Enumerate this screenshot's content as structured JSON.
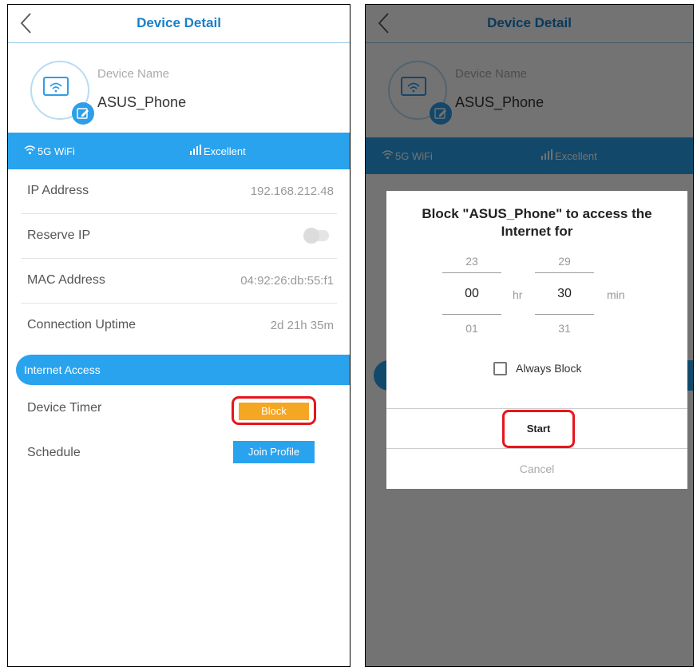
{
  "header": {
    "title": "Device Detail"
  },
  "device": {
    "name_label": "Device Name",
    "name": "ASUS_Phone"
  },
  "wifi_bar": {
    "band": "5G WiFi",
    "signal": "Excellent"
  },
  "rows": [
    {
      "label": "IP Address",
      "value": "192.168.212.48"
    },
    {
      "label": "Reserve IP",
      "value": ""
    },
    {
      "label": "MAC Address",
      "value": "04:92:26:db:55:f1"
    },
    {
      "label": "Connection Uptime",
      "value": "2d 21h 35m"
    }
  ],
  "internet_access": {
    "title": "Internet Access",
    "device_timer_label": "Device Timer",
    "block_label": "Block",
    "schedule_label": "Schedule",
    "join_label": "Join Profile"
  },
  "dialog": {
    "title": "Block \"ASUS_Phone\" to access the Internet for",
    "hours": {
      "prev": "23",
      "current": "00",
      "next": "01",
      "unit": "hr"
    },
    "minutes": {
      "prev": "29",
      "current": "30",
      "next": "31",
      "unit": "min"
    },
    "always_block_label": "Always Block",
    "always_block_checked": false,
    "start_label": "Start",
    "cancel_label": "Cancel"
  },
  "colors": {
    "accent": "#29a3ee",
    "title_blue": "#1a7fc8",
    "block_orange": "#f5a623",
    "highlight_red": "#e8151c"
  }
}
